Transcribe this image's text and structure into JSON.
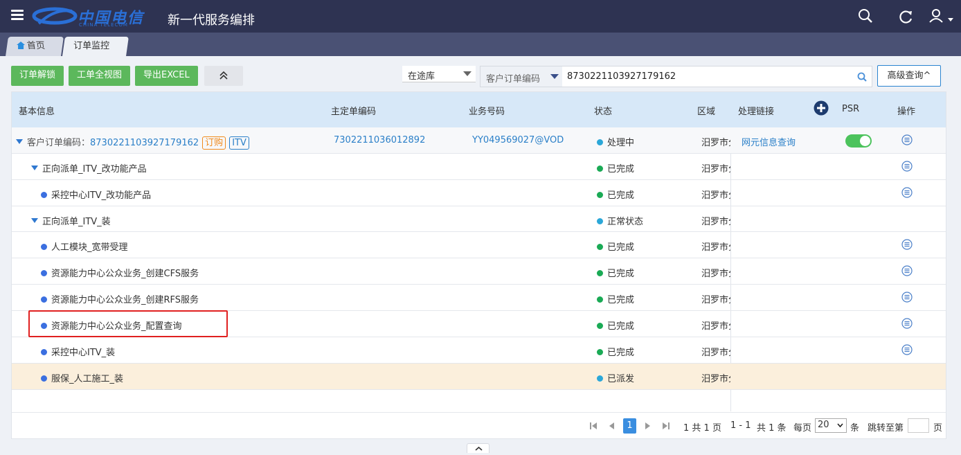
{
  "header": {
    "logo_cn": "中国电信",
    "logo_en": "CHINA TELECOM",
    "title": "新一代服务编排"
  },
  "tabs": [
    {
      "label": "首页",
      "icon": "home-icon"
    },
    {
      "label": "订单监控"
    }
  ],
  "toolbar": {
    "unlock_label": "订单解锁",
    "full_view_label": "工单全视图",
    "export_label": "导出EXCEL",
    "depot_select": "在途库",
    "search_field": "客户订单编码",
    "search_value": "8730221103927179162",
    "advanced_label": "高级查询^"
  },
  "table": {
    "headers": {
      "basic": "基本信息",
      "main_order": "主定单编码",
      "biz_no": "业务号码",
      "status": "状态",
      "region": "区域",
      "link": "处理链接",
      "psr": "PSR",
      "ops": "操作"
    },
    "rows": [
      {
        "name_prefix": "客户订单编码：",
        "name": "8730221103927179162",
        "tags": [
          "订购",
          "ITV"
        ],
        "main_order": "7302211036012892",
        "biz_no": "YY049569027@VOD",
        "status": "处理中",
        "status_color": "blue",
        "region": "汨罗市分",
        "link": "网元信息查询",
        "psr": true,
        "op": true
      },
      {
        "name": "正向派单_ITV_改功能产品",
        "status": "已完成",
        "status_color": "green",
        "region": "汨罗市分",
        "op": true
      },
      {
        "name": "采控中心ITV_改功能产品",
        "status": "已完成",
        "status_color": "green",
        "region": "汨罗市分",
        "op": true
      },
      {
        "name": "正向派单_ITV_装",
        "status": "正常状态",
        "status_color": "blue",
        "region": "汨罗市分",
        "op": false
      },
      {
        "name": "人工模块_宽带受理",
        "status": "已完成",
        "status_color": "green",
        "region": "汨罗市分",
        "op": true
      },
      {
        "name": "资源能力中心公众业务_创建CFS服务",
        "status": "已完成",
        "status_color": "green",
        "region": "汨罗市分",
        "op": true
      },
      {
        "name": "资源能力中心公众业务_创建RFS服务",
        "status": "已完成",
        "status_color": "green",
        "region": "汨罗市分",
        "op": true
      },
      {
        "name": "资源能力中心公众业务_配置查询",
        "status": "已完成",
        "status_color": "green",
        "region": "汨罗市分",
        "op": true
      },
      {
        "name": "采控中心ITV_装",
        "status": "已完成",
        "status_color": "green",
        "region": "汨罗市分",
        "op": true
      },
      {
        "name": "服保_人工施工_装",
        "status": "已派发",
        "status_color": "blue",
        "region": "汨罗市分",
        "op": false
      }
    ]
  },
  "pager": {
    "current_page": "1",
    "page_total": "1 共 1 页",
    "range": "1 - 1",
    "total": "共 1 条",
    "per_page_label": "每页",
    "per_page": "20",
    "unit": "条",
    "jump_label": "跳转至第",
    "page_unit": "页"
  },
  "colors": {
    "header_bg": "#2e3352",
    "green_btn": "#5cb85c",
    "link": "#2a7fc8",
    "highlight_row": "#fbefdc",
    "red_box": "#e02020"
  }
}
